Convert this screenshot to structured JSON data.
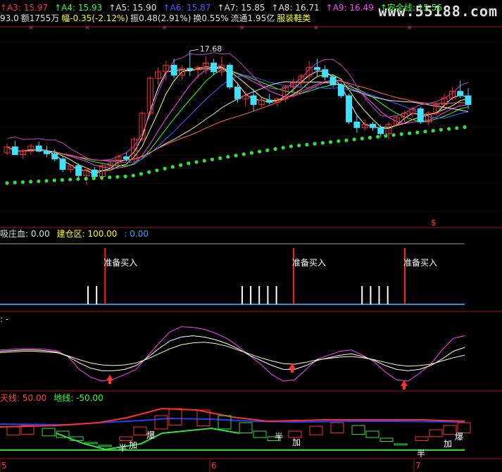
{
  "watermark": "www.55188.com",
  "header": {
    "row1": [
      {
        "text": "A3: 15.97",
        "color": "#ff3030",
        "arrow": "up"
      },
      {
        "text": "A4: 15.93",
        "color": "#30ff30",
        "arrow": "up"
      },
      {
        "text": "A5: 15.90",
        "color": "#e0e0e0",
        "arrow": "up"
      },
      {
        "text": "A6: 15.87",
        "color": "#4060ff",
        "arrow": "up"
      },
      {
        "text": "A7: 15.85",
        "color": "#e0e0e0",
        "arrow": "up"
      },
      {
        "text": "A8: 16.71",
        "color": "#e0e0e0",
        "arrow": "up"
      },
      {
        "text": "A9: 16.49",
        "color": "#ff40ff",
        "arrow": "up"
      },
      {
        "text": "安全线: 15.56",
        "color": "#30ff30",
        "arrow": "up"
      }
    ],
    "row2": [
      {
        "text": "93.0",
        "color": "#e0e0e0"
      },
      {
        "text": "额1755万",
        "color": "#e0e0e0"
      },
      {
        "text": "幅-0.35(-2.12%)",
        "color": "#ffff00"
      },
      {
        "text": "振0.48(2.91%)",
        "color": "#e0e0e0"
      },
      {
        "text": "换0.55%",
        "color": "#e0e0e0"
      },
      {
        "text": "流通1.95亿",
        "color": "#e0e0e0"
      },
      {
        "text": "服装鞋类",
        "color": "#ffff00"
      }
    ]
  },
  "main_panel": {
    "high_label": "17.68",
    "dollar_marker": "$"
  },
  "panel2": {
    "title_parts": [
      {
        "text": "吸庄血: 0.00",
        "color": "#e0e0e0"
      },
      {
        "text": "建仓区: 100.00",
        "color": "#ffff00"
      },
      {
        "text": ": 0.00",
        "color": "#40a0ff"
      }
    ],
    "signal_label": "准备买入"
  },
  "panel3": {
    "title": ": -"
  },
  "panel4": {
    "title_parts": [
      {
        "text": "天线: 50.00",
        "color": "#ff4040"
      },
      {
        "text": "地线: -50.00",
        "color": "#30ff30"
      }
    ],
    "markers": {
      "ban": "半",
      "jia": "加",
      "bao": "爆"
    }
  },
  "x_axis": {
    "labels": [
      "5",
      "6",
      "7"
    ]
  },
  "chart_data": [
    {
      "type": "candlestick",
      "name": "price",
      "ylim": [
        14.0,
        18.2
      ],
      "ohlc": [
        [
          15.34,
          15.55,
          15.3,
          15.48
        ],
        [
          15.48,
          15.62,
          15.3,
          15.3
        ],
        [
          15.3,
          15.42,
          15.2,
          15.38
        ],
        [
          15.38,
          15.55,
          15.3,
          15.5
        ],
        [
          15.5,
          15.6,
          15.35,
          15.38
        ],
        [
          15.38,
          15.5,
          15.25,
          15.32
        ],
        [
          15.32,
          15.42,
          15.15,
          15.2
        ],
        [
          15.2,
          15.26,
          14.9,
          14.96
        ],
        [
          14.96,
          15.08,
          14.88,
          15.05
        ],
        [
          15.05,
          15.1,
          14.72,
          14.82
        ],
        [
          14.82,
          15.0,
          14.6,
          14.95
        ],
        [
          14.95,
          15.02,
          14.72,
          14.8
        ],
        [
          14.8,
          15.1,
          14.7,
          15.05
        ],
        [
          15.05,
          15.15,
          14.92,
          15.1
        ],
        [
          15.1,
          15.3,
          15.05,
          15.25
        ],
        [
          15.25,
          15.35,
          15.15,
          15.2
        ],
        [
          15.2,
          15.7,
          15.15,
          15.65
        ],
        [
          15.65,
          16.3,
          15.6,
          16.25
        ],
        [
          16.25,
          17.1,
          16.2,
          17.05
        ],
        [
          17.05,
          17.3,
          16.9,
          17.2
        ],
        [
          17.2,
          17.45,
          17.0,
          17.35
        ],
        [
          17.35,
          17.5,
          17.05,
          17.12
        ],
        [
          17.12,
          17.35,
          17.02,
          17.28
        ],
        [
          17.28,
          17.68,
          17.1,
          17.25
        ],
        [
          17.25,
          17.35,
          17.05,
          17.3
        ],
        [
          17.3,
          17.55,
          17.15,
          17.4
        ],
        [
          17.4,
          17.5,
          17.12,
          17.2
        ],
        [
          17.2,
          17.55,
          17.1,
          17.35
        ],
        [
          17.35,
          17.4,
          16.8,
          16.85
        ],
        [
          16.85,
          16.95,
          16.5,
          16.58
        ],
        [
          16.58,
          16.75,
          16.4,
          16.65
        ],
        [
          16.65,
          16.8,
          16.3,
          16.45
        ],
        [
          16.45,
          16.6,
          16.38,
          16.55
        ],
        [
          16.55,
          16.7,
          16.45,
          16.5
        ],
        [
          16.5,
          16.62,
          16.4,
          16.58
        ],
        [
          16.58,
          16.9,
          16.5,
          16.85
        ],
        [
          16.85,
          17.05,
          16.75,
          16.95
        ],
        [
          16.95,
          17.15,
          16.85,
          17.1
        ],
        [
          17.1,
          17.45,
          17.0,
          17.3
        ],
        [
          17.3,
          17.5,
          17.1,
          17.25
        ],
        [
          17.25,
          17.35,
          17.0,
          17.08
        ],
        [
          17.08,
          17.15,
          16.85,
          16.9
        ],
        [
          16.9,
          16.95,
          16.6,
          16.65
        ],
        [
          16.65,
          16.7,
          16.0,
          16.05
        ],
        [
          16.05,
          16.2,
          15.8,
          15.92
        ],
        [
          15.92,
          16.1,
          15.85,
          16.0
        ],
        [
          16.0,
          16.05,
          15.85,
          15.92
        ],
        [
          15.92,
          15.98,
          15.7,
          15.78
        ],
        [
          15.78,
          16.05,
          15.65,
          16.0
        ],
        [
          16.0,
          16.2,
          15.95,
          16.15
        ],
        [
          16.15,
          16.3,
          16.05,
          16.25
        ],
        [
          16.25,
          16.4,
          16.15,
          16.35
        ],
        [
          16.35,
          16.4,
          16.0,
          16.05
        ],
        [
          16.05,
          16.3,
          15.98,
          16.25
        ],
        [
          16.25,
          16.5,
          16.2,
          16.45
        ],
        [
          16.45,
          16.7,
          16.4,
          16.6
        ],
        [
          16.6,
          16.85,
          16.55,
          16.75
        ],
        [
          16.75,
          17.0,
          16.6,
          16.65
        ],
        [
          16.65,
          16.82,
          16.35,
          16.45
        ]
      ],
      "safety_line_dots": [
        14.65,
        14.66,
        14.67,
        14.68,
        14.69,
        14.7,
        14.71,
        14.72,
        14.73,
        14.74,
        14.75,
        14.76,
        14.77,
        14.78,
        14.79,
        14.8,
        14.82,
        14.86,
        14.9,
        14.94,
        14.98,
        15.02,
        15.06,
        15.1,
        15.13,
        15.16,
        15.19,
        15.22,
        15.25,
        15.28,
        15.31,
        15.34,
        15.37,
        15.4,
        15.43,
        15.46,
        15.49,
        15.51,
        15.53,
        15.55,
        15.57,
        15.59,
        15.61,
        15.63,
        15.65,
        15.67,
        15.69,
        15.71,
        15.73,
        15.75,
        15.77,
        15.79,
        15.81,
        15.83,
        15.85,
        15.87,
        15.89,
        15.91,
        15.93
      ]
    },
    {
      "type": "bar",
      "name": "signals",
      "ylim": [
        0,
        100
      ],
      "signal_bars": [
        {
          "i": 10,
          "h": 26,
          "color": "#ffffff"
        },
        {
          "i": 11,
          "h": 26,
          "color": "#ffffff"
        },
        {
          "i": 12,
          "h": 80,
          "color": "#ff2020"
        },
        {
          "i": 28,
          "h": 26,
          "color": "#ffffff"
        },
        {
          "i": 29,
          "h": 26,
          "color": "#ffffff"
        },
        {
          "i": 30,
          "h": 26,
          "color": "#ffffff"
        },
        {
          "i": 31,
          "h": 26,
          "color": "#ffffff"
        },
        {
          "i": 32,
          "h": 26,
          "color": "#ffffff"
        },
        {
          "i": 34,
          "h": 80,
          "color": "#ff2020"
        },
        {
          "i": 42,
          "h": 26,
          "color": "#ffffff"
        },
        {
          "i": 43,
          "h": 26,
          "color": "#ffffff"
        },
        {
          "i": 44,
          "h": 26,
          "color": "#ffffff"
        },
        {
          "i": 45,
          "h": 26,
          "color": "#ffffff"
        },
        {
          "i": 47,
          "h": 80,
          "color": "#ff2020"
        }
      ]
    },
    {
      "type": "line",
      "name": "oscillator",
      "ylim": [
        0,
        100
      ],
      "series": [
        {
          "color": "#ff40ff",
          "values": [
            60,
            61,
            62,
            62,
            61,
            59,
            50,
            30,
            18,
            12,
            15,
            22,
            30,
            50,
            70,
            88,
            96,
            95,
            92,
            86,
            78,
            66,
            52,
            38,
            22,
            12,
            14,
            30,
            46,
            52,
            58,
            60,
            52,
            42,
            26,
            14,
            12,
            24,
            38,
            60,
            78,
            82
          ]
        },
        {
          "color": "#ffffff",
          "values": [
            58,
            59,
            60,
            60,
            59,
            57,
            50,
            40,
            32,
            28,
            28,
            30,
            36,
            48,
            62,
            74,
            80,
            82,
            80,
            76,
            70,
            62,
            52,
            44,
            36,
            30,
            30,
            36,
            44,
            48,
            52,
            54,
            50,
            44,
            36,
            30,
            28,
            30,
            36,
            46,
            58,
            64
          ]
        },
        {
          "color": "#ffffa0",
          "values": [
            56,
            57,
            58,
            58,
            57,
            56,
            51,
            45,
            40,
            37,
            36,
            37,
            40,
            46,
            54,
            62,
            68,
            71,
            72,
            70,
            66,
            60,
            54,
            48,
            43,
            39,
            38,
            41,
            45,
            47,
            49,
            50,
            48,
            45,
            41,
            37,
            35,
            36,
            38,
            43,
            48,
            52
          ]
        }
      ]
    },
    {
      "type": "bar",
      "name": "tianxian_dixian",
      "ylim": [
        -60,
        60
      ],
      "upper_line": 50,
      "lower_line": -50
    }
  ]
}
